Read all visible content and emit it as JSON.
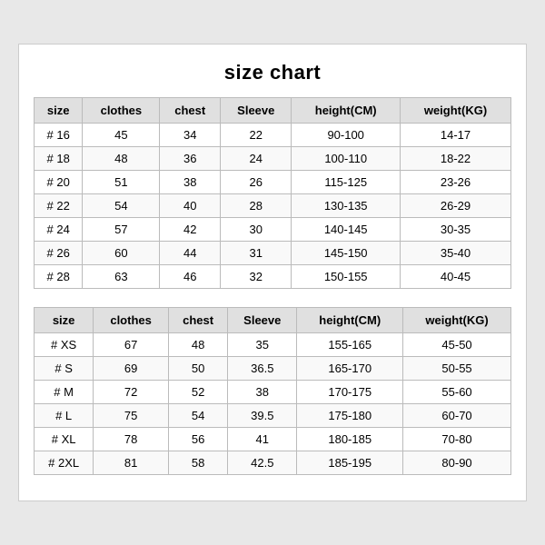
{
  "title": "size chart",
  "section1": {
    "headers": [
      "size",
      "clothes",
      "chest",
      "Sleeve",
      "height(CM)",
      "weight(KG)"
    ],
    "rows": [
      [
        "# 16",
        "45",
        "34",
        "22",
        "90-100",
        "14-17"
      ],
      [
        "# 18",
        "48",
        "36",
        "24",
        "100-110",
        "18-22"
      ],
      [
        "# 20",
        "51",
        "38",
        "26",
        "115-125",
        "23-26"
      ],
      [
        "# 22",
        "54",
        "40",
        "28",
        "130-135",
        "26-29"
      ],
      [
        "# 24",
        "57",
        "42",
        "30",
        "140-145",
        "30-35"
      ],
      [
        "# 26",
        "60",
        "44",
        "31",
        "145-150",
        "35-40"
      ],
      [
        "# 28",
        "63",
        "46",
        "32",
        "150-155",
        "40-45"
      ]
    ]
  },
  "section2": {
    "headers": [
      "size",
      "clothes",
      "chest",
      "Sleeve",
      "height(CM)",
      "weight(KG)"
    ],
    "rows": [
      [
        "# XS",
        "67",
        "48",
        "35",
        "155-165",
        "45-50"
      ],
      [
        "# S",
        "69",
        "50",
        "36.5",
        "165-170",
        "50-55"
      ],
      [
        "# M",
        "72",
        "52",
        "38",
        "170-175",
        "55-60"
      ],
      [
        "# L",
        "75",
        "54",
        "39.5",
        "175-180",
        "60-70"
      ],
      [
        "# XL",
        "78",
        "56",
        "41",
        "180-185",
        "70-80"
      ],
      [
        "# 2XL",
        "81",
        "58",
        "42.5",
        "185-195",
        "80-90"
      ]
    ]
  }
}
